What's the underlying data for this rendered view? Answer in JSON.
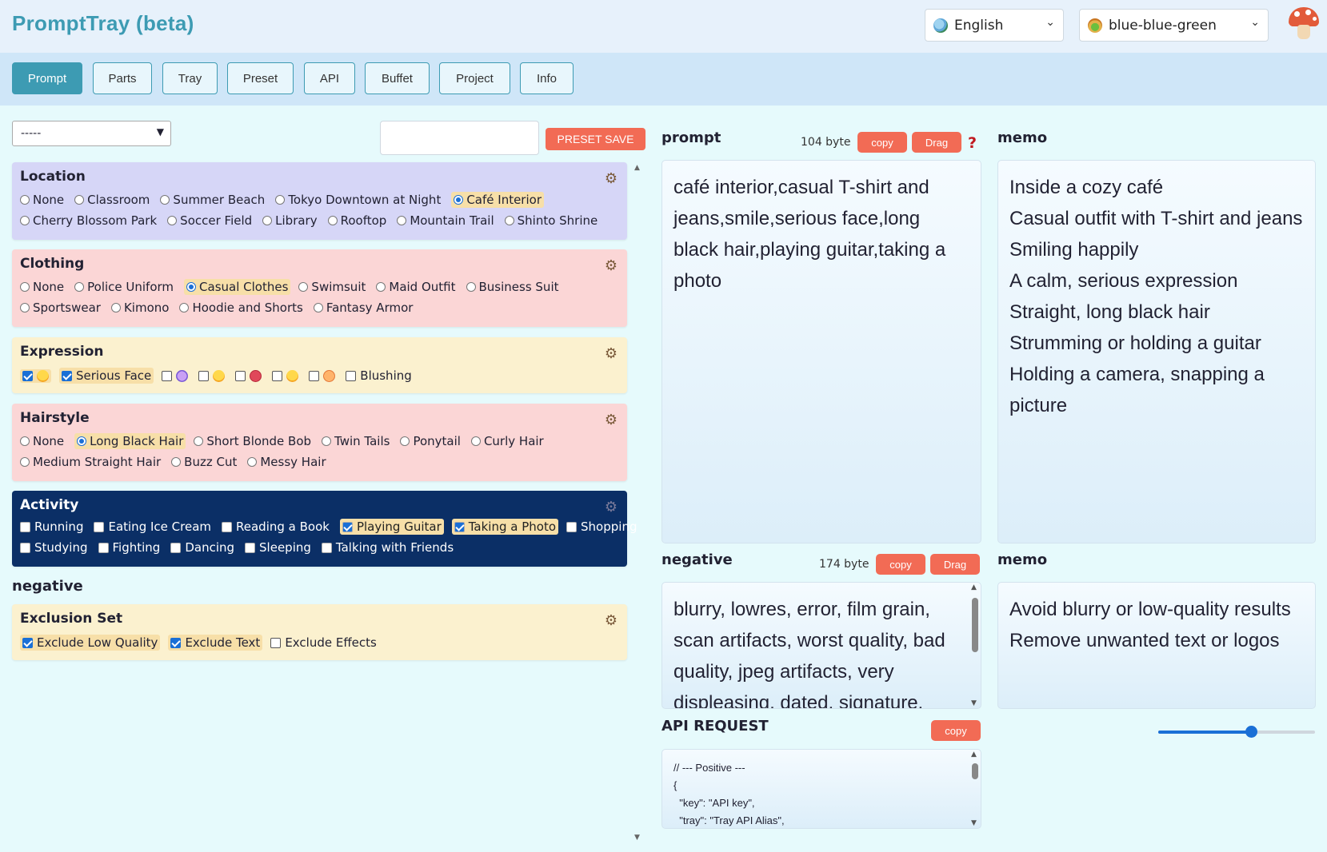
{
  "app": {
    "title": "PromptTray (beta)"
  },
  "header": {
    "language": "English",
    "theme": "blue-blue-green"
  },
  "tabs": [
    {
      "label": "Prompt",
      "active": true
    },
    {
      "label": "Parts"
    },
    {
      "label": "Tray"
    },
    {
      "label": "Preset"
    },
    {
      "label": "API"
    },
    {
      "label": "Buffet"
    },
    {
      "label": "Project"
    },
    {
      "label": "Info"
    }
  ],
  "preset": {
    "select_value": "-----",
    "input_value": "",
    "save_label": "PRESET SAVE"
  },
  "location": {
    "title": "Location",
    "row1": [
      "None",
      "Classroom",
      "Summer Beach",
      "Tokyo Downtown at Night",
      "Café Interior"
    ],
    "row2": [
      "Cherry Blossom Park",
      "Soccer Field",
      "Library",
      "Rooftop",
      "Mountain Trail",
      "Shinto Shrine"
    ],
    "selected": "Café Interior"
  },
  "clothing": {
    "title": "Clothing",
    "row1": [
      "None",
      "Police Uniform",
      "Casual Clothes",
      "Swimsuit",
      "Maid Outfit",
      "Business Suit"
    ],
    "row2": [
      "Sportswear",
      "Kimono",
      "Hoodie and Shorts",
      "Fantasy Armor"
    ],
    "selected": "Casual Clothes"
  },
  "expression": {
    "title": "Expression",
    "items": [
      {
        "label": "",
        "emoji": "smile-emoji",
        "checked": true
      },
      {
        "label": "Serious Face",
        "checked": true
      },
      {
        "label": "",
        "emoji": "shocked-emoji",
        "checked": false
      },
      {
        "label": "",
        "emoji": "grin-emoji",
        "checked": false
      },
      {
        "label": "",
        "emoji": "angry-emoji",
        "checked": false
      },
      {
        "label": "",
        "emoji": "wink-emoji",
        "checked": false
      },
      {
        "label": "",
        "emoji": "kiss-emoji",
        "checked": false
      },
      {
        "label": "Blushing",
        "checked": false
      }
    ]
  },
  "hairstyle": {
    "title": "Hairstyle",
    "row1": [
      "None",
      "Long Black Hair",
      "Short Blonde Bob",
      "Twin Tails",
      "Ponytail",
      "Curly Hair"
    ],
    "row2": [
      "Medium Straight Hair",
      "Buzz Cut",
      "Messy Hair"
    ],
    "selected": "Long Black Hair"
  },
  "activity": {
    "title": "Activity",
    "row1": [
      {
        "label": "Running",
        "checked": false
      },
      {
        "label": "Eating Ice Cream",
        "checked": false
      },
      {
        "label": "Reading a Book",
        "checked": false
      },
      {
        "label": "Playing Guitar",
        "checked": true
      },
      {
        "label": "Taking a Photo",
        "checked": true
      },
      {
        "label": "Shopping",
        "checked": false
      }
    ],
    "row2": [
      {
        "label": "Studying",
        "checked": false
      },
      {
        "label": "Fighting",
        "checked": false
      },
      {
        "label": "Dancing",
        "checked": false
      },
      {
        "label": "Sleeping",
        "checked": false
      },
      {
        "label": "Talking with Friends",
        "checked": false
      }
    ]
  },
  "negative_section": {
    "label": "negative"
  },
  "exclusion": {
    "title": "Exclusion Set",
    "items": [
      {
        "label": "Exclude Low Quality",
        "checked": true
      },
      {
        "label": "Exclude Text",
        "checked": true
      },
      {
        "label": "Exclude Effects",
        "checked": false
      }
    ]
  },
  "prompt_panel": {
    "label": "prompt",
    "bytes": "104 byte",
    "copy": "copy",
    "drag": "Drag",
    "help": "?",
    "text": "café interior,casual T-shirt and jeans,smile,serious face,long black hair,playing guitar,taking a photo"
  },
  "prompt_memo": {
    "label": "memo",
    "lines": [
      "Inside a cozy café",
      "Casual outfit with T-shirt and jeans",
      "Smiling happily",
      "A calm, serious expression",
      "Straight, long black hair",
      "Strumming or holding a guitar",
      "Holding a camera, snapping a picture"
    ]
  },
  "negative_panel": {
    "label": "negative",
    "bytes": "174 byte",
    "copy": "copy",
    "drag": "Drag",
    "text": "blurry, lowres, error, film grain, scan artifacts, worst quality, bad quality, jpeg artifacts, very displeasing, dated, signature,"
  },
  "negative_memo": {
    "label": "memo",
    "lines": [
      "Avoid blurry or low-quality results",
      "Remove unwanted text or logos"
    ]
  },
  "api": {
    "label": "API REQUEST",
    "copy": "copy",
    "lines": [
      "// --- Positive ---",
      "{",
      "  \"key\": \"API key\",",
      "  \"tray\": \"Tray API Alias\","
    ]
  },
  "font_size_slider": {
    "value": 0.6
  },
  "colors": {
    "accent": "#3d9bb3",
    "button": "#f26b55",
    "activity_bg": "#0b2f66"
  }
}
